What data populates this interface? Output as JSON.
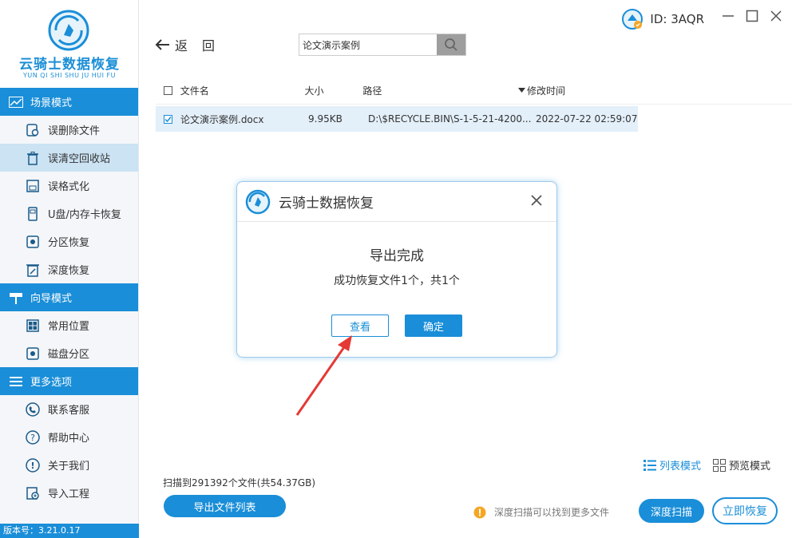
{
  "app": {
    "title": "云骑士数据恢复",
    "subtitle": "YUN QI SHI SHU JU HUI FU",
    "version": "版本号：3.21.0.17",
    "user_id": "ID: 3AQR"
  },
  "sidebar": {
    "sections": [
      {
        "title": "场景模式",
        "items": [
          {
            "label": "误删除文件"
          },
          {
            "label": "误清空回收站"
          },
          {
            "label": "误格式化"
          },
          {
            "label": "U盘/内存卡恢复"
          },
          {
            "label": "分区恢复"
          },
          {
            "label": "深度恢复"
          }
        ]
      },
      {
        "title": "向导模式",
        "items": [
          {
            "label": "常用位置"
          },
          {
            "label": "磁盘分区"
          }
        ]
      },
      {
        "title": "更多选项",
        "items": [
          {
            "label": "联系客服"
          },
          {
            "label": "帮助中心"
          },
          {
            "label": "关于我们"
          },
          {
            "label": "导入工程"
          }
        ]
      }
    ],
    "active_item": "误清空回收站"
  },
  "toolbar": {
    "back_label": "返回",
    "search_value": "论文演示案例"
  },
  "table": {
    "headers": {
      "name": "文件名",
      "size": "大小",
      "path": "路径",
      "time": "修改时间"
    },
    "rows": [
      {
        "name": "论文演示案例.docx",
        "size": "9.95KB",
        "path": "D:\\$RECYCLE.BIN\\S-1-5-21-4200...",
        "time": "2022-07-22 02:59:07",
        "checked": true
      }
    ]
  },
  "dialog": {
    "title": "云骑士数据恢复",
    "message_title": "导出完成",
    "message_detail": "成功恢复文件1个，共1个",
    "view_label": "查看",
    "ok_label": "确定"
  },
  "bottom": {
    "list_mode_label": "列表模式",
    "preview_mode_label": "预览模式",
    "scan_info": "扫描到291392个文件(共54.37GB)",
    "export_label": "导出文件列表",
    "hint": "深度扫描可以找到更多文件",
    "deep_scan_label": "深度扫描",
    "recover_label": "立即恢复"
  },
  "colors": {
    "accent": "#1a8ed8",
    "active_bg": "#cbe3f3",
    "warning": "#f5a623",
    "arrow": "#e53935"
  }
}
